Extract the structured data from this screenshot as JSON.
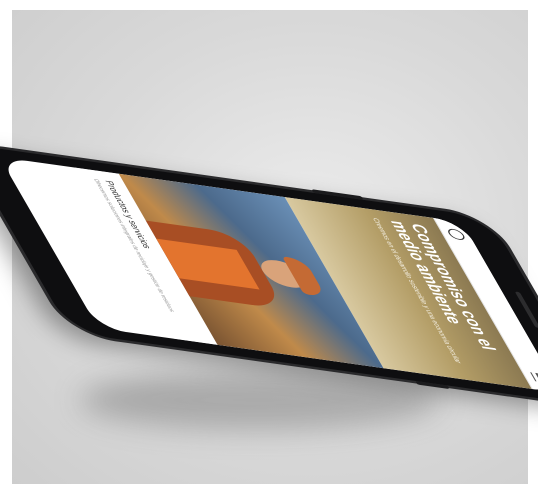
{
  "hero": {
    "title": "Compromiso con el medio ambiente",
    "subtitle": "Creemos en el desarrollo sostenible y una economía circular"
  },
  "products": {
    "title": "Productos y servicios",
    "text": "Ofrecemos soluciones integrales de reciclaje y gestión de residuos"
  },
  "colors": {
    "background": "#d9d9d9",
    "phone_body": "#0e0e10",
    "hero_tint": "#b39d66",
    "vest": "#e3742e"
  }
}
